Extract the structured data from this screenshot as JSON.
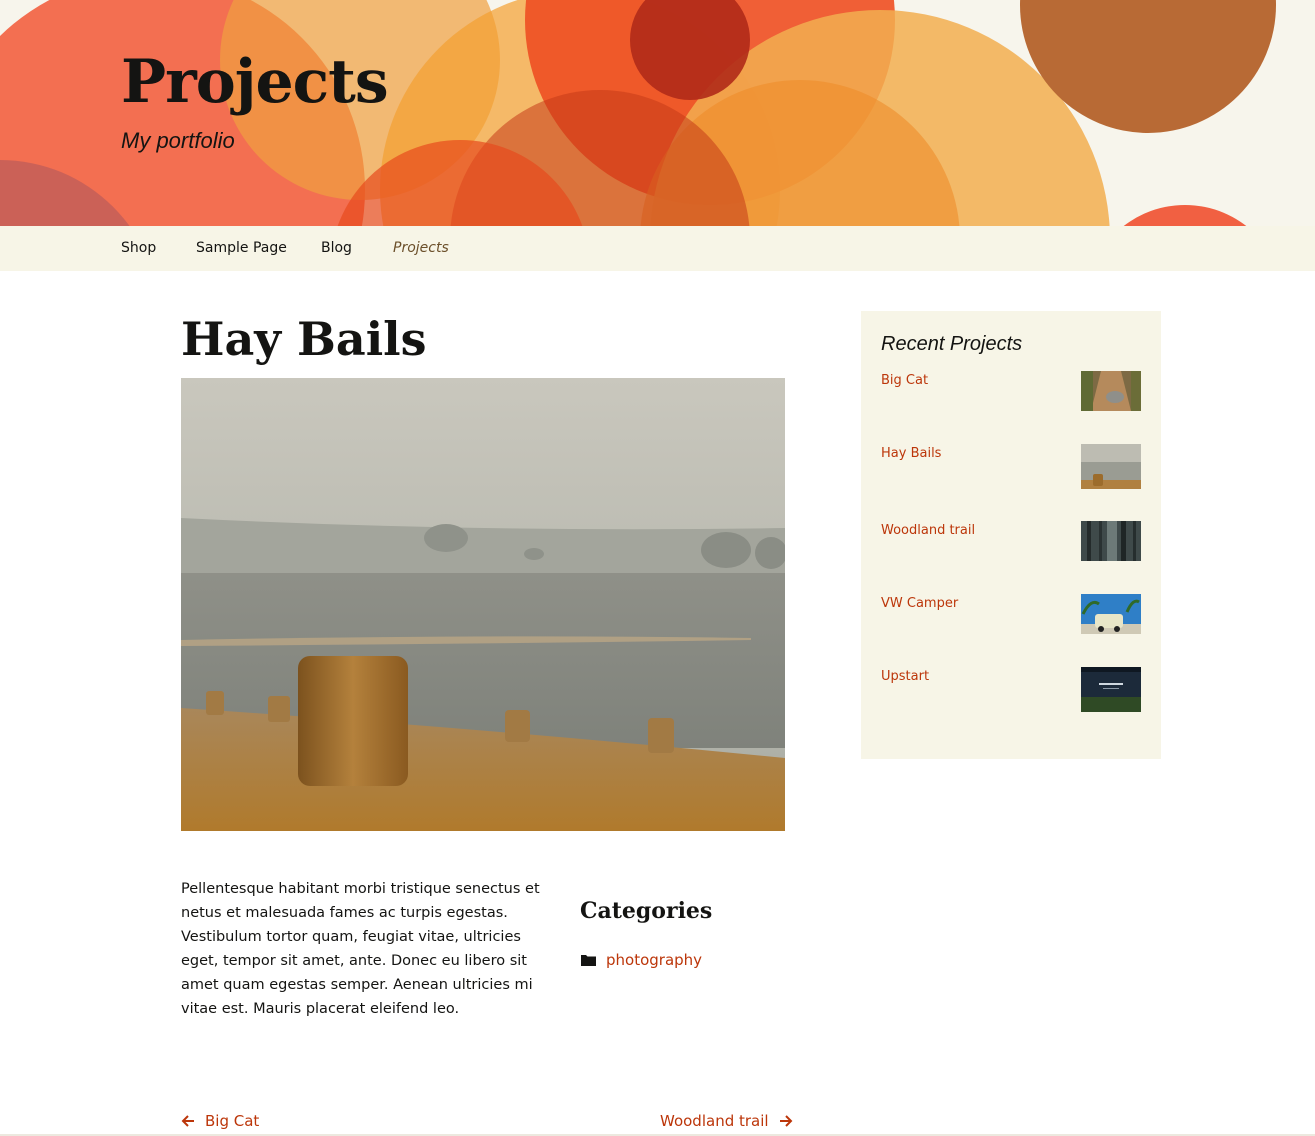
{
  "site": {
    "title": "Projects",
    "description": "My portfolio"
  },
  "nav": {
    "items": [
      {
        "label": "Shop"
      },
      {
        "label": "Sample Page"
      },
      {
        "label": "Blog"
      },
      {
        "label": "Projects"
      }
    ],
    "current": "Projects"
  },
  "entry": {
    "title": "Hay Bails",
    "content": "Pellentesque habitant morbi tristique senectus et netus et malesuada fames ac turpis egestas. Vestibulum tortor quam, feugiat vitae, ultricies eget, tempor sit amet, ante. Donec eu libero sit amet quam egestas semper. Aenean ultricies mi vitae est. Mauris placerat eleifend leo."
  },
  "categories": {
    "title": "Categories",
    "items": [
      {
        "label": "photography"
      }
    ]
  },
  "widget": {
    "title": "Recent Projects",
    "items": [
      {
        "label": "Big Cat"
      },
      {
        "label": "Hay Bails"
      },
      {
        "label": "Woodland trail"
      },
      {
        "label": "VW Camper"
      },
      {
        "label": "Upstart"
      }
    ]
  },
  "post_nav": {
    "previous": "Big Cat",
    "next": "Woodland trail"
  },
  "icons": {
    "folder": "folder-icon",
    "prev": "arrow-left-icon",
    "next": "arrow-right-icon"
  },
  "colors": {
    "accent": "#bc360a",
    "header_bg": "#f7f5ec",
    "nav_bg": "#f7f5e7",
    "widget_bg": "#f7f5e7",
    "text": "#141412"
  }
}
